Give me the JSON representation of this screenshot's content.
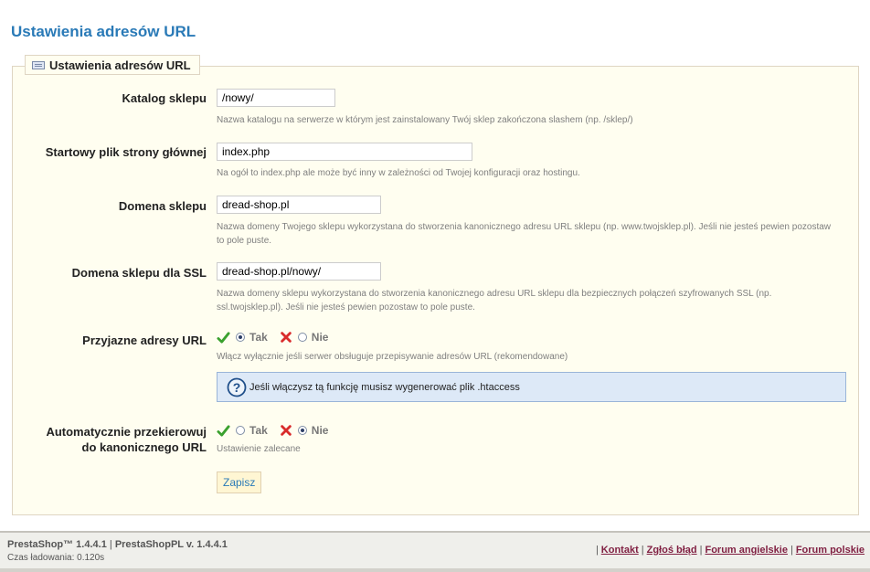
{
  "page": {
    "title": "Ustawienia adresów URL",
    "legend": "Ustawienia adresów URL"
  },
  "fields": {
    "catalog": {
      "label": "Katalog sklepu",
      "value": "/nowy/",
      "hint": "Nazwa katalogu na serwerze w którym jest zainstalowany Twój sklep zakończona slashem (np. /sklep/)"
    },
    "start_file": {
      "label": "Startowy plik strony głównej",
      "value": "index.php",
      "hint": "Na ogół to index.php ale może być inny w zależności od Twojej konfiguracji oraz hostingu."
    },
    "domain": {
      "label": "Domena sklepu",
      "value": "dread-shop.pl",
      "hint": "Nazwa domeny Twojego sklepu wykorzystana do stworzenia kanonicznego adresu URL sklepu (np. www.twojsklep.pl). Jeśli nie jesteś pewien pozostaw to pole puste."
    },
    "ssl_domain": {
      "label": "Domena sklepu dla SSL",
      "value": "dread-shop.pl/nowy/",
      "hint": "Nazwa domeny sklepu wykorzystana do stworzenia kanonicznego adresu URL sklepu dla bezpiecznych połączeń szyfrowanych SSL (np. ssl.twojsklep.pl). Jeśli nie jesteś pewien pozostaw to pole puste."
    },
    "friendly_urls": {
      "label": "Przyjazne adresy URL",
      "yes": "Tak",
      "no": "Nie",
      "selected": "yes",
      "hint": "Włącz wyłącznie jeśli serwer obsługuje przepisywanie adresów URL (rekomendowane)",
      "info_prefix": "Jeśli włączysz tą funkcję musisz",
      "info_link": "wygenerować plik .htaccess"
    },
    "canonical_redirect": {
      "label_line1": "Automatycznie przekierowuj",
      "label_line2": "do kanonicznego URL",
      "yes": "Tak",
      "no": "Nie",
      "selected": "no",
      "hint": "Ustawienie zalecane"
    }
  },
  "save_label": "Zapisz",
  "footer": {
    "brand": "PrestaShop™ 1.4.4.1",
    "separator": "|",
    "version": "PrestaShopPL v. 1.4.4.1",
    "load_time": "Czas ładowania: 0.120s",
    "links": [
      "Kontakt",
      "Zgłoś błąd",
      "Forum angielskie",
      "Forum polskie"
    ]
  },
  "colors": {
    "accent": "#2a7ab7",
    "panel_bg": "#fffef0",
    "info_bg": "#dde9f7",
    "footer_link": "#812143"
  }
}
